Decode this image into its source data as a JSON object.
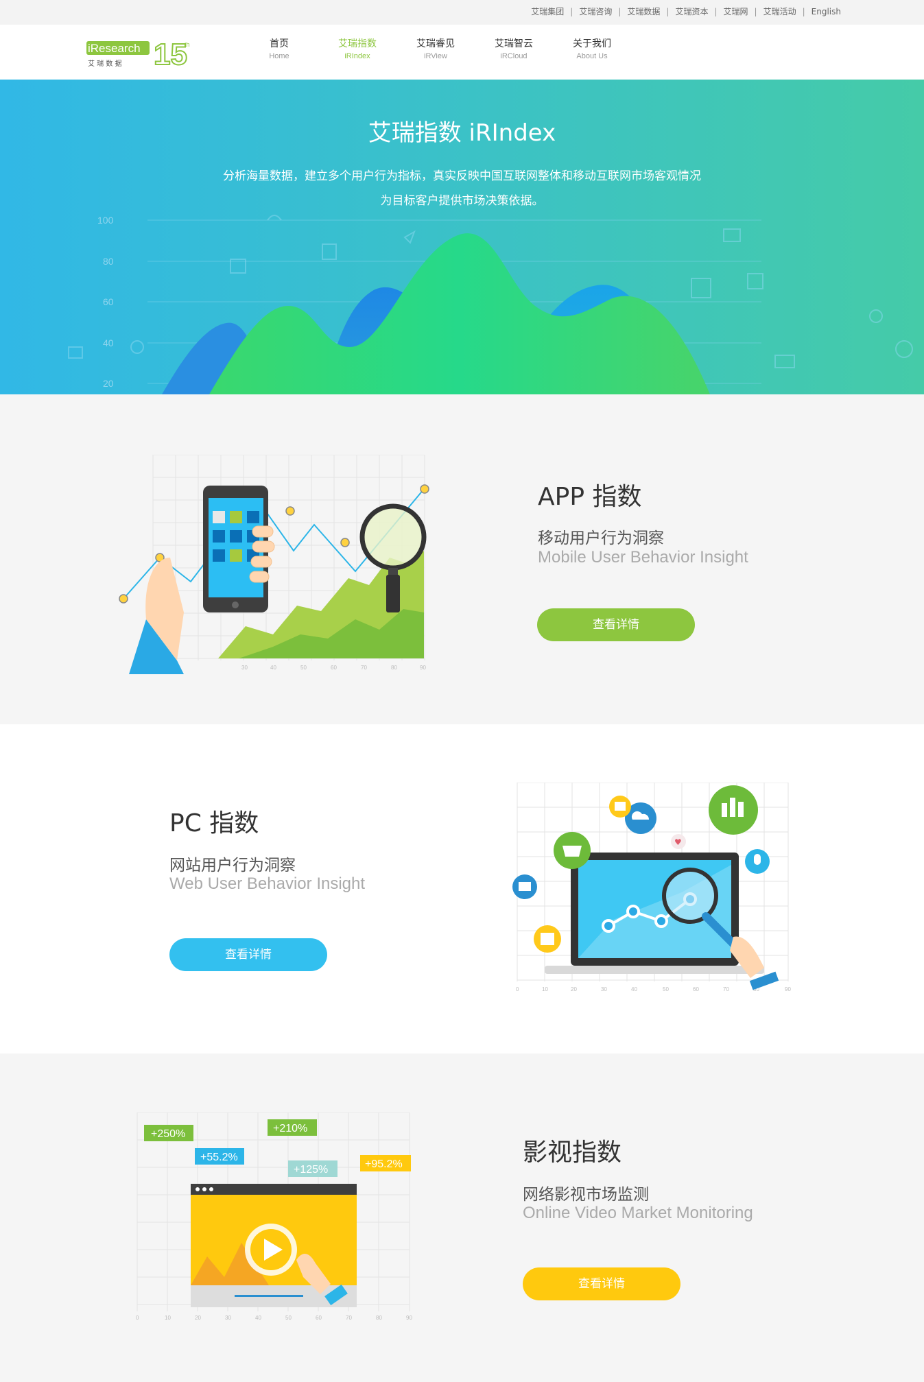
{
  "topbar": {
    "links": [
      "艾瑞集团",
      "艾瑞咨询",
      "艾瑞数据",
      "艾瑞资本",
      "艾瑞网",
      "艾瑞活动",
      "English"
    ]
  },
  "header": {
    "logo_text": "iResearch",
    "logo_sub": "艾 瑞 数 据",
    "logo_badge": "15th",
    "nav": [
      {
        "zh": "首页",
        "en": "Home"
      },
      {
        "zh": "艾瑞指数",
        "en": "iRIndex"
      },
      {
        "zh": "艾瑞睿见",
        "en": "iRView"
      },
      {
        "zh": "艾瑞智云",
        "en": "iRCloud"
      },
      {
        "zh": "关于我们",
        "en": "About Us"
      }
    ],
    "active_index": 1
  },
  "hero": {
    "title": "艾瑞指数 iRIndex",
    "desc_line1": "分析海量数据，建立多个用户行为指标，真实反映中国互联网整体和移动互联网市场客观情况",
    "desc_line2": "为目标客户提供市场决策依据。",
    "axis_labels": [
      "100",
      "80",
      "60",
      "40",
      "20"
    ]
  },
  "sections": [
    {
      "title": "APP 指数",
      "subtitle": "移动用户行为洞察",
      "subtitle_en": "Mobile User Behavior Insight",
      "button": "查看详情",
      "color": "#8dc63f"
    },
    {
      "title": "PC 指数",
      "subtitle": "网站用户行为洞察",
      "subtitle_en": "Web User Behavior Insight",
      "button": "查看详情",
      "color": "#33c0ef"
    },
    {
      "title": "影视指数",
      "subtitle": "网络影视市场监测",
      "subtitle_en": "Online Video Market Monitoring",
      "button": "查看详情",
      "color": "#ffc90e"
    }
  ],
  "illustration_axis": [
    "0",
    "10",
    "20",
    "30",
    "40",
    "50",
    "60",
    "70",
    "80",
    "90"
  ],
  "video_badges": [
    "+250%",
    "+55.2%",
    "+210%",
    "+125%",
    "+95.2%"
  ]
}
